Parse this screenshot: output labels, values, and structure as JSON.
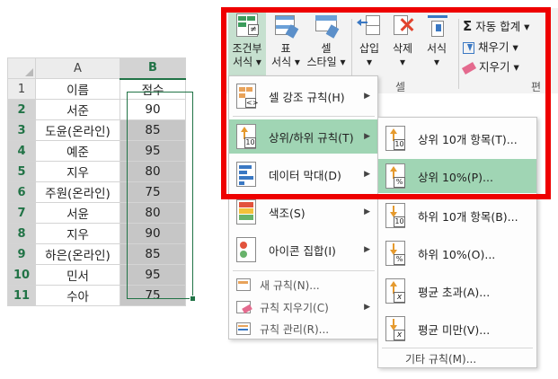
{
  "sheet": {
    "col_a": "A",
    "col_b": "B",
    "header_row": {
      "num": "1",
      "a": "이름",
      "b": "점수"
    },
    "rows": [
      {
        "num": "2",
        "a": "서준",
        "b": "90"
      },
      {
        "num": "3",
        "a": "도윤(온라인)",
        "b": "85"
      },
      {
        "num": "4",
        "a": "예준",
        "b": "95"
      },
      {
        "num": "5",
        "a": "지우",
        "b": "80"
      },
      {
        "num": "6",
        "a": "주원(온라인)",
        "b": "75"
      },
      {
        "num": "7",
        "a": "서윤",
        "b": "80"
      },
      {
        "num": "8",
        "a": "지우",
        "b": "90"
      },
      {
        "num": "9",
        "a": "하은(온라인)",
        "b": "85"
      },
      {
        "num": "10",
        "a": "민서",
        "b": "95"
      },
      {
        "num": "11",
        "a": "수아",
        "b": "75"
      }
    ]
  },
  "ribbon": {
    "cond_format_1": "조건부",
    "cond_format_2": "서식 ▾",
    "table_1": "표",
    "table_2": "서식 ▾",
    "cell_style_1": "셀",
    "cell_style_2": "스타일 ▾",
    "insert": "삽입",
    "delete": "삭제",
    "format": "서식",
    "insert_arrow": "▾",
    "delete_arrow": "▾",
    "format_arrow": "▾",
    "group_cells": "셀",
    "group_edit": "편",
    "autosum": "자동 합계 ▾",
    "fill": "채우기 ▾",
    "clear": "지우기 ▾"
  },
  "main_menu": {
    "highlight_rules": "셀 강조 규칙(H)",
    "top_bottom_rules": "상위/하위 규칙(T)",
    "data_bars": "데이터 막대(D)",
    "color_scales": "색조(S)",
    "icon_sets": "아이콘 집합(I)",
    "new_rule": "새 규칙(N)...",
    "clear_rules": "규칙 지우기(C)",
    "manage_rules": "규칙 관리(R)...",
    "arrow": "▶"
  },
  "sub_menu": {
    "top10_items": "상위 10개 항목(T)...",
    "top10_percent": "상위 10%(P)...",
    "bottom10_items": "하위 10개 항목(B)...",
    "bottom10_percent": "하위 10%(O)...",
    "above_average": "평균 초과(A)...",
    "below_average": "평균 미만(V)...",
    "more_rules": "기타 규칙(M)..."
  },
  "icons": {
    "sheet_text_10": "10",
    "sheet_text_pct": "%",
    "sheet_text_x": "x",
    "sigma": "Σ"
  },
  "colors": {
    "accent_green": "#217346",
    "highlight_green": "#a0d5b4",
    "red_frame": "#ee0000",
    "selected_cell_gray": "#c6c6c6"
  }
}
